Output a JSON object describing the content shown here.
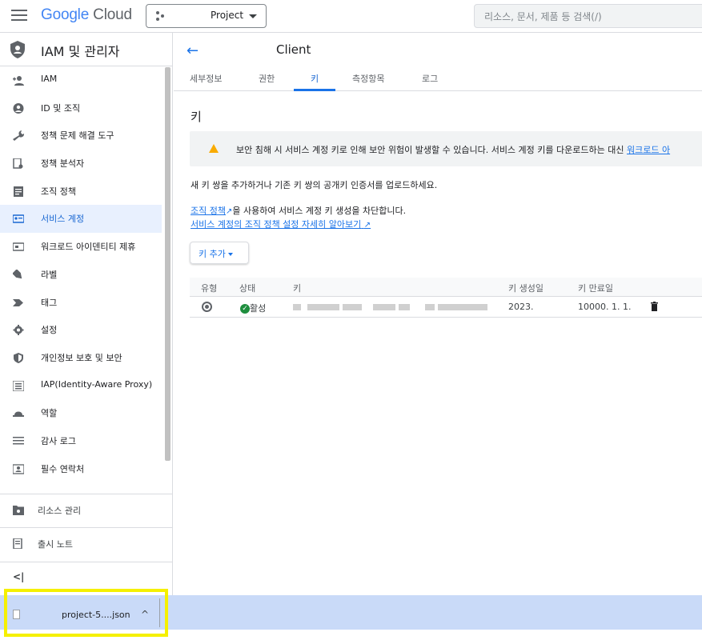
{
  "header": {
    "logo_google": "Google",
    "logo_cloud": "Cloud",
    "project_label": "Project",
    "search_placeholder": "리소스, 문서, 제품 등 검색(/)"
  },
  "sidebar": {
    "title": "IAM 및 관리자",
    "items": [
      {
        "label": "IAM",
        "icon": "person-add-icon"
      },
      {
        "label": "ID 및 조직",
        "icon": "account-circle-icon"
      },
      {
        "label": "정책 문제 해결 도구",
        "icon": "wrench-icon"
      },
      {
        "label": "정책 분석자",
        "icon": "policy-doc-icon"
      },
      {
        "label": "조직 정책",
        "icon": "article-icon"
      },
      {
        "label": "서비스 계정",
        "icon": "service-account-icon"
      },
      {
        "label": "워크로드 아이덴티티 제휴",
        "icon": "card-icon"
      },
      {
        "label": "라벨",
        "icon": "label-icon"
      },
      {
        "label": "태그",
        "icon": "tag-icon"
      },
      {
        "label": "설정",
        "icon": "gear-icon"
      },
      {
        "label": "개인정보 보호 및 보안",
        "icon": "shield-icon"
      },
      {
        "label": "IAP(Identity-Aware Proxy)",
        "icon": "iap-icon"
      },
      {
        "label": "역할",
        "icon": "hat-icon"
      },
      {
        "label": "감사 로그",
        "icon": "list-icon"
      },
      {
        "label": "필수 연락처",
        "icon": "contact-icon"
      }
    ],
    "active_index": 5,
    "resource_mgmt": "리소스 관리",
    "release_notes": "출시 노트",
    "collapse_label": "<|"
  },
  "main": {
    "title": "Client",
    "tabs": [
      "세부정보",
      "권한",
      "키",
      "측정항목",
      "로그"
    ],
    "active_tab": "키",
    "section_title": "키",
    "warning_text": "보안 침해 시 서비스 계정 키로 인해 보안 위험이 발생할 수 있습니다. 서비스 계정 키를 다운로드하는 대신 ",
    "warning_link": "워크로드 아",
    "intro": "새 키 쌍을 추가하거나 기존 키 쌍의 공개키 인증서를 업로드하세요.",
    "policy_link": "조직 정책",
    "policy_text": "을 사용하여 서비스 계정 키 생성을 차단합니다.",
    "learn_more": "서비스 계정의 조직 정책 설정 자세히 알아보기",
    "add_key": "키 추가",
    "table": {
      "headers": [
        "유형",
        "상태",
        "키",
        "키 생성일",
        "키 만료일"
      ],
      "rows": [
        {
          "status": "활성",
          "created": "2023.",
          "expires": "10000. 1. 1."
        }
      ]
    }
  },
  "download": {
    "filename": "project-5....json",
    "chevron": "^"
  },
  "colors": {
    "accent": "#1a73e8",
    "active_bg": "#e8f0fe",
    "warning": "#f9ab00",
    "success": "#1e8e3e",
    "download_bar": "#c9daf8",
    "highlight": "#f5f000"
  }
}
